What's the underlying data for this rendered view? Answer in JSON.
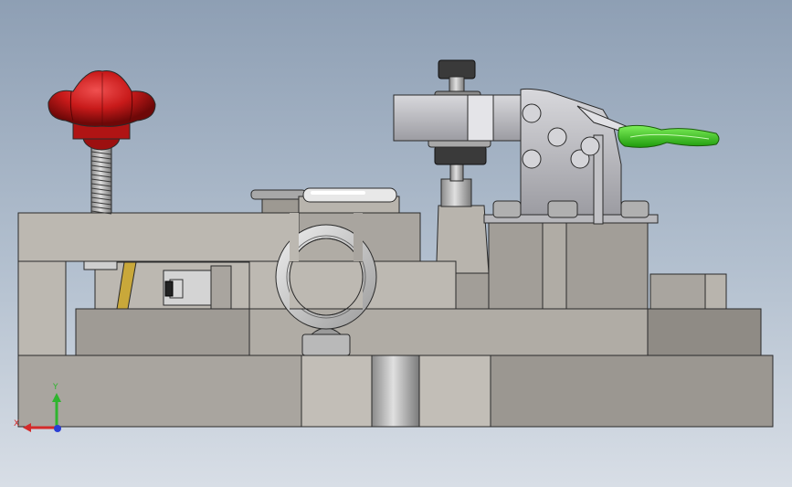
{
  "viewport": {
    "background_top": "#8e9fb4",
    "background_bottom": "#d8dee6"
  },
  "model": {
    "parts": [
      "base-plate",
      "middle-block",
      "upper-plate",
      "lifting-eye-bolt",
      "star-knob",
      "threaded-stud",
      "toggle-clamp",
      "clamp-handle",
      "slotted-cap"
    ],
    "colors": {
      "steel": "#a9a59f",
      "steel_dark": "#8d8983",
      "knob": "#c81a1a",
      "clamp_handle": "#39c21e",
      "eye_bolt": "#c9c9c9"
    }
  },
  "triad": {
    "y_label": "Y",
    "x_label": "X",
    "y_color": "#2fb52f",
    "x_color": "#d42a2a",
    "z_color": "#2a3fd4"
  }
}
